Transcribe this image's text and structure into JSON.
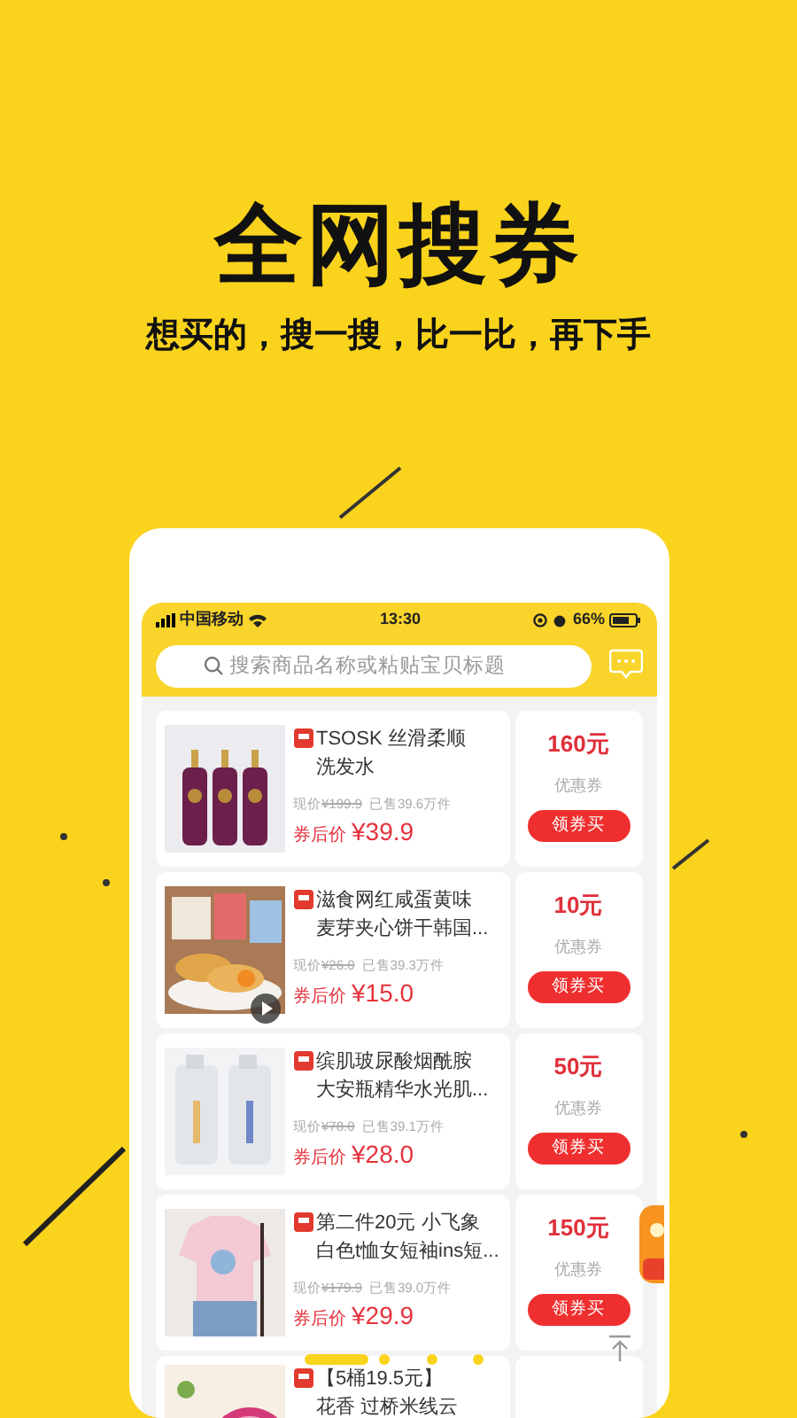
{
  "headline": "全网搜券",
  "tagline": "想买的，搜一搜，比一比，再下手",
  "status_bar": {
    "carrier": "中国移动",
    "time": "13:30",
    "battery": "66%"
  },
  "search": {
    "placeholder": "搜索商品名称或粘贴宝贝标题"
  },
  "products": [
    {
      "title_lines": [
        "TSOSK 丝滑柔顺",
        "洗发水"
      ],
      "list_price_label": "现价",
      "list_price": "¥199.9",
      "sold": "已售39.6万件",
      "final_label": "券后价",
      "final_price": "¥39.9",
      "coupon": "160元",
      "coupon_label": "优惠券",
      "button": "领券买",
      "video": false,
      "promo_badge": false
    },
    {
      "title_lines": [
        "滋食网红咸蛋黄味",
        "麦芽夹心饼干韩国..."
      ],
      "list_price_label": "现价",
      "list_price": "¥26.0",
      "sold": "已售39.3万件",
      "final_label": "券后价",
      "final_price": "¥15.0",
      "coupon": "10元",
      "coupon_label": "优惠券",
      "button": "领券买",
      "video": true,
      "promo_badge": false
    },
    {
      "title_lines": [
        "缤肌玻尿酸烟酰胺",
        "大安瓶精华水光肌..."
      ],
      "list_price_label": "现价",
      "list_price": "¥78.0",
      "sold": "已售39.1万件",
      "final_label": "券后价",
      "final_price": "¥28.0",
      "coupon": "50元",
      "coupon_label": "优惠券",
      "button": "领券买",
      "video": false,
      "promo_badge": false
    },
    {
      "title_lines": [
        "第二件20元 小飞象",
        "白色t恤女短袖ins短..."
      ],
      "list_price_label": "现价",
      "list_price": "¥179.9",
      "sold": "已售39.0万件",
      "final_label": "券后价",
      "final_price": "¥29.9",
      "coupon": "150元",
      "coupon_label": "优惠券",
      "button": "领券买",
      "video": false,
      "promo_badge": true
    },
    {
      "title_lines": [
        "【5桶19.5元】",
        "花香 过桥米线云"
      ],
      "video": false,
      "promo_badge": false
    }
  ]
}
